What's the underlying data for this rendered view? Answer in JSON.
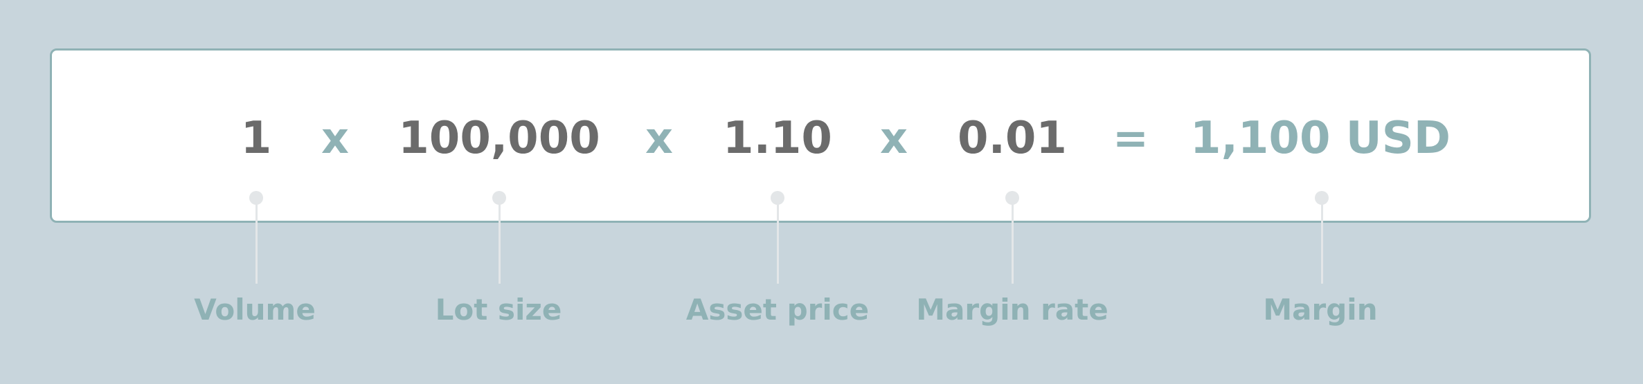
{
  "formula": {
    "terms": [
      {
        "id": "volume",
        "value": "1",
        "label": "Volume"
      },
      {
        "id": "lot-size",
        "value": "100,000",
        "label": "Lot size"
      },
      {
        "id": "asset-price",
        "value": "1.10",
        "label": "Asset price"
      },
      {
        "id": "margin-rate",
        "value": "0.01",
        "label": "Margin rate"
      }
    ],
    "operators": [
      "x",
      "x",
      "x",
      "="
    ],
    "result": {
      "value": "1,100 USD",
      "label": "Margin"
    }
  },
  "colors": {
    "background": "#c8d5dc",
    "card": "#ffffff",
    "accent": "#8fb2b5",
    "term_text": "#6b6b6b",
    "connector": "#e3e6e8"
  }
}
